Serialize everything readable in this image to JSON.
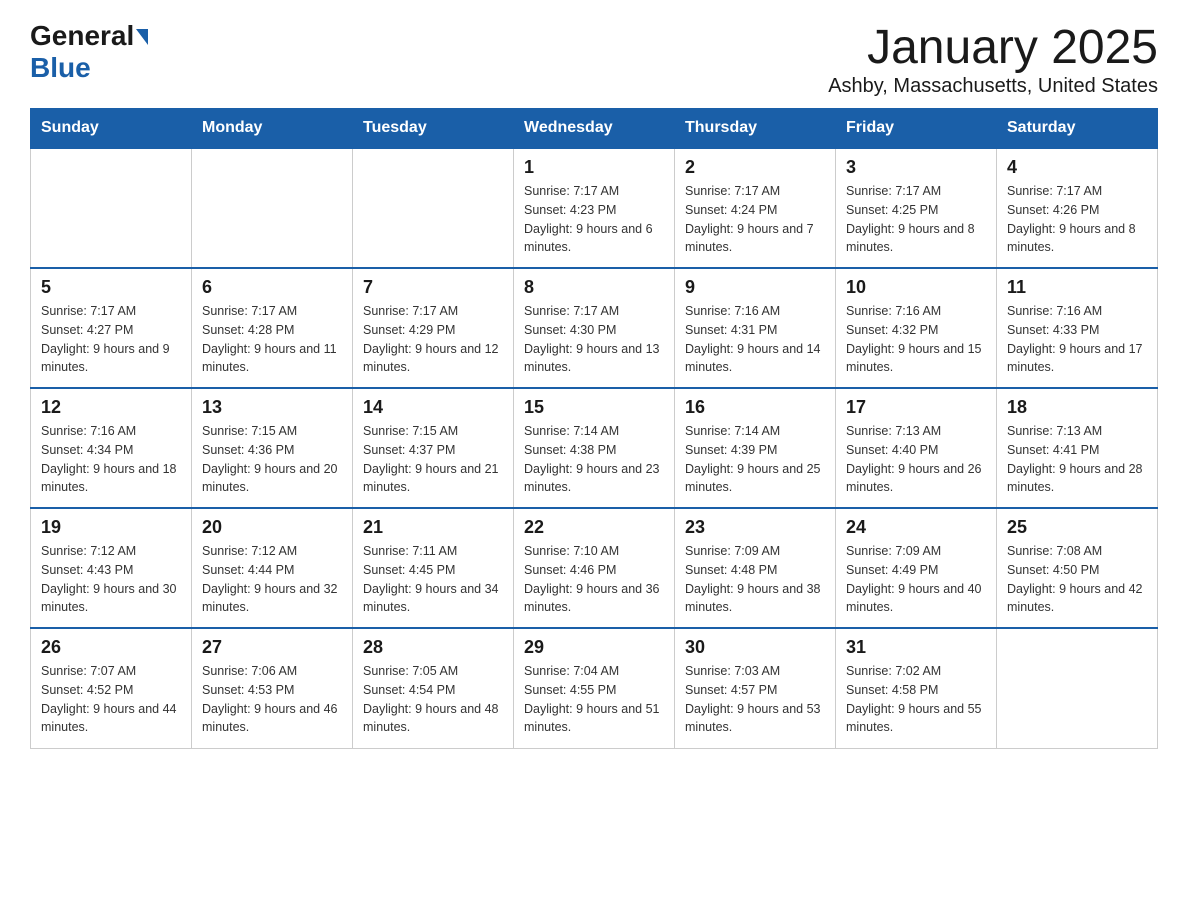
{
  "header": {
    "logo_general": "General",
    "logo_blue": "Blue",
    "month_title": "January 2025",
    "location": "Ashby, Massachusetts, United States"
  },
  "days_of_week": [
    "Sunday",
    "Monday",
    "Tuesday",
    "Wednesday",
    "Thursday",
    "Friday",
    "Saturday"
  ],
  "weeks": [
    [
      {
        "day": "",
        "info": ""
      },
      {
        "day": "",
        "info": ""
      },
      {
        "day": "",
        "info": ""
      },
      {
        "day": "1",
        "info": "Sunrise: 7:17 AM\nSunset: 4:23 PM\nDaylight: 9 hours and 6 minutes."
      },
      {
        "day": "2",
        "info": "Sunrise: 7:17 AM\nSunset: 4:24 PM\nDaylight: 9 hours and 7 minutes."
      },
      {
        "day": "3",
        "info": "Sunrise: 7:17 AM\nSunset: 4:25 PM\nDaylight: 9 hours and 8 minutes."
      },
      {
        "day": "4",
        "info": "Sunrise: 7:17 AM\nSunset: 4:26 PM\nDaylight: 9 hours and 8 minutes."
      }
    ],
    [
      {
        "day": "5",
        "info": "Sunrise: 7:17 AM\nSunset: 4:27 PM\nDaylight: 9 hours and 9 minutes."
      },
      {
        "day": "6",
        "info": "Sunrise: 7:17 AM\nSunset: 4:28 PM\nDaylight: 9 hours and 11 minutes."
      },
      {
        "day": "7",
        "info": "Sunrise: 7:17 AM\nSunset: 4:29 PM\nDaylight: 9 hours and 12 minutes."
      },
      {
        "day": "8",
        "info": "Sunrise: 7:17 AM\nSunset: 4:30 PM\nDaylight: 9 hours and 13 minutes."
      },
      {
        "day": "9",
        "info": "Sunrise: 7:16 AM\nSunset: 4:31 PM\nDaylight: 9 hours and 14 minutes."
      },
      {
        "day": "10",
        "info": "Sunrise: 7:16 AM\nSunset: 4:32 PM\nDaylight: 9 hours and 15 minutes."
      },
      {
        "day": "11",
        "info": "Sunrise: 7:16 AM\nSunset: 4:33 PM\nDaylight: 9 hours and 17 minutes."
      }
    ],
    [
      {
        "day": "12",
        "info": "Sunrise: 7:16 AM\nSunset: 4:34 PM\nDaylight: 9 hours and 18 minutes."
      },
      {
        "day": "13",
        "info": "Sunrise: 7:15 AM\nSunset: 4:36 PM\nDaylight: 9 hours and 20 minutes."
      },
      {
        "day": "14",
        "info": "Sunrise: 7:15 AM\nSunset: 4:37 PM\nDaylight: 9 hours and 21 minutes."
      },
      {
        "day": "15",
        "info": "Sunrise: 7:14 AM\nSunset: 4:38 PM\nDaylight: 9 hours and 23 minutes."
      },
      {
        "day": "16",
        "info": "Sunrise: 7:14 AM\nSunset: 4:39 PM\nDaylight: 9 hours and 25 minutes."
      },
      {
        "day": "17",
        "info": "Sunrise: 7:13 AM\nSunset: 4:40 PM\nDaylight: 9 hours and 26 minutes."
      },
      {
        "day": "18",
        "info": "Sunrise: 7:13 AM\nSunset: 4:41 PM\nDaylight: 9 hours and 28 minutes."
      }
    ],
    [
      {
        "day": "19",
        "info": "Sunrise: 7:12 AM\nSunset: 4:43 PM\nDaylight: 9 hours and 30 minutes."
      },
      {
        "day": "20",
        "info": "Sunrise: 7:12 AM\nSunset: 4:44 PM\nDaylight: 9 hours and 32 minutes."
      },
      {
        "day": "21",
        "info": "Sunrise: 7:11 AM\nSunset: 4:45 PM\nDaylight: 9 hours and 34 minutes."
      },
      {
        "day": "22",
        "info": "Sunrise: 7:10 AM\nSunset: 4:46 PM\nDaylight: 9 hours and 36 minutes."
      },
      {
        "day": "23",
        "info": "Sunrise: 7:09 AM\nSunset: 4:48 PM\nDaylight: 9 hours and 38 minutes."
      },
      {
        "day": "24",
        "info": "Sunrise: 7:09 AM\nSunset: 4:49 PM\nDaylight: 9 hours and 40 minutes."
      },
      {
        "day": "25",
        "info": "Sunrise: 7:08 AM\nSunset: 4:50 PM\nDaylight: 9 hours and 42 minutes."
      }
    ],
    [
      {
        "day": "26",
        "info": "Sunrise: 7:07 AM\nSunset: 4:52 PM\nDaylight: 9 hours and 44 minutes."
      },
      {
        "day": "27",
        "info": "Sunrise: 7:06 AM\nSunset: 4:53 PM\nDaylight: 9 hours and 46 minutes."
      },
      {
        "day": "28",
        "info": "Sunrise: 7:05 AM\nSunset: 4:54 PM\nDaylight: 9 hours and 48 minutes."
      },
      {
        "day": "29",
        "info": "Sunrise: 7:04 AM\nSunset: 4:55 PM\nDaylight: 9 hours and 51 minutes."
      },
      {
        "day": "30",
        "info": "Sunrise: 7:03 AM\nSunset: 4:57 PM\nDaylight: 9 hours and 53 minutes."
      },
      {
        "day": "31",
        "info": "Sunrise: 7:02 AM\nSunset: 4:58 PM\nDaylight: 9 hours and 55 minutes."
      },
      {
        "day": "",
        "info": ""
      }
    ]
  ]
}
